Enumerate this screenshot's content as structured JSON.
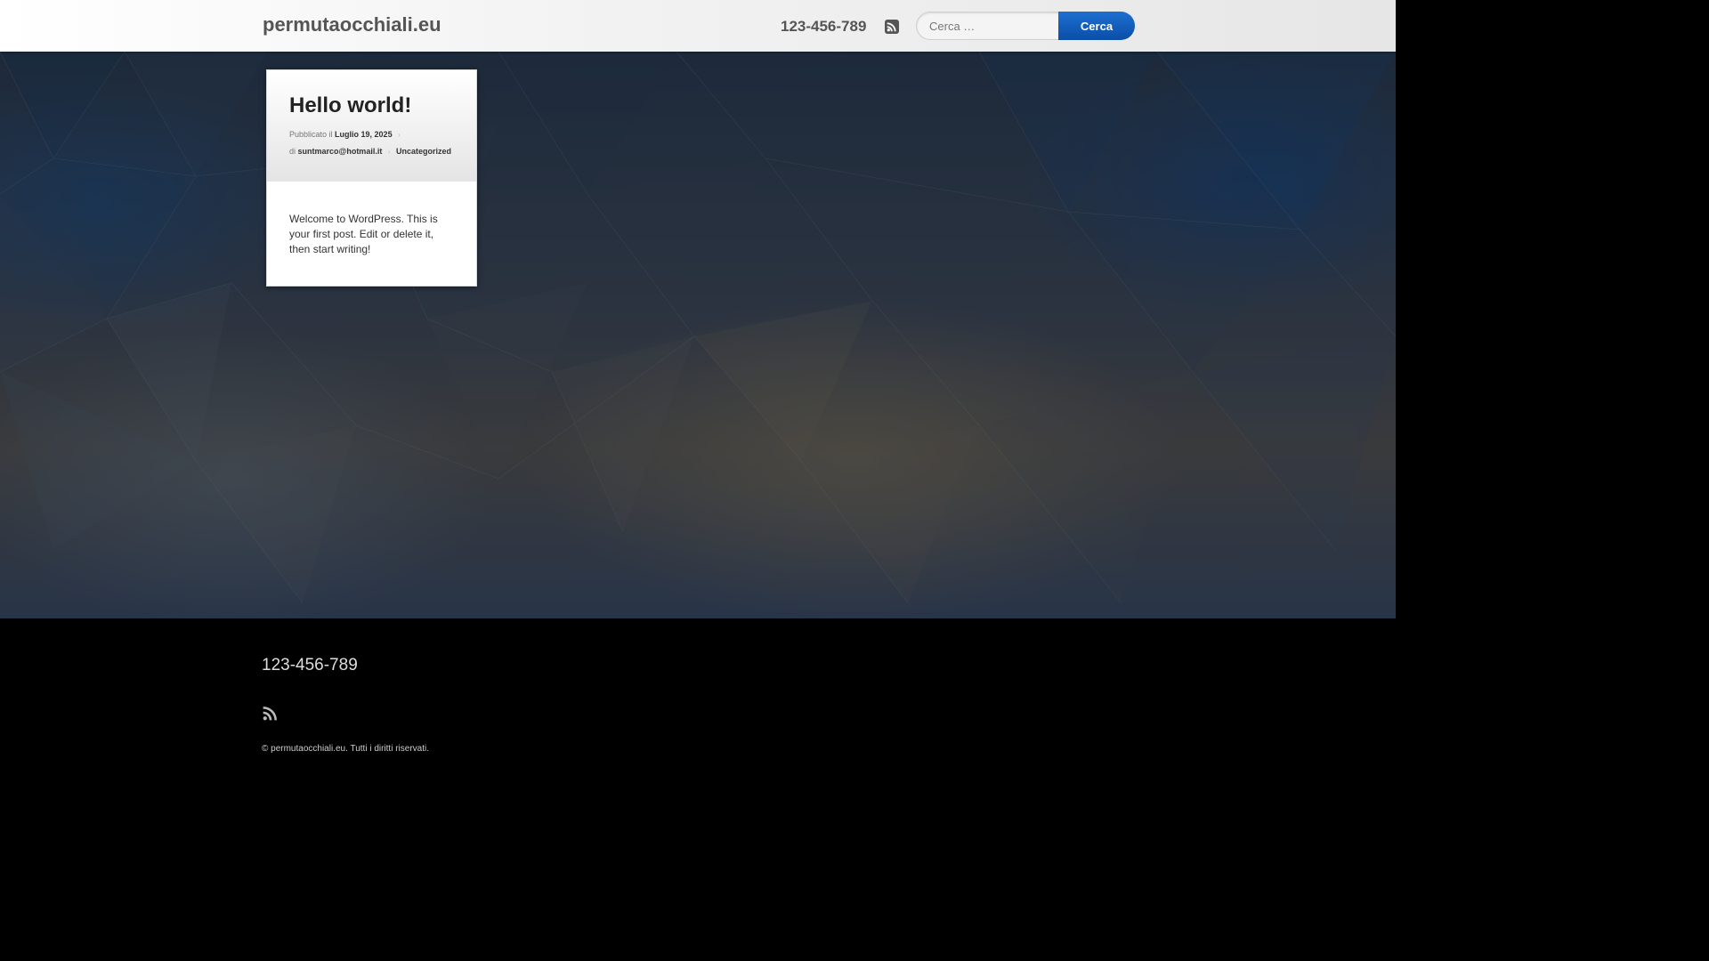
{
  "header": {
    "site_title": "permutaocchiali.eu",
    "phone": "123-456-789",
    "rss_icon": "rss-icon",
    "search": {
      "placeholder": "Cerca …",
      "button_label": "Cerca"
    }
  },
  "post": {
    "title": "Hello world!",
    "published_prefix": "Pubblicato il",
    "date": "Luglio 19, 2025",
    "author_prefix": "di",
    "author": "suntmarco@hotmail.it",
    "category": "Uncategorized",
    "body": "Welcome to WordPress. This is your first post. Edit or delete it, then start writing!"
  },
  "footer": {
    "phone": "123-456-789",
    "rss_icon": "rss-icon",
    "copyright": "© permutaocchiali.eu. Tutti i diritti riservati."
  },
  "colors": {
    "accent": "#0a4fa8",
    "footer_bg": "#000000",
    "header_text": "#555555"
  }
}
